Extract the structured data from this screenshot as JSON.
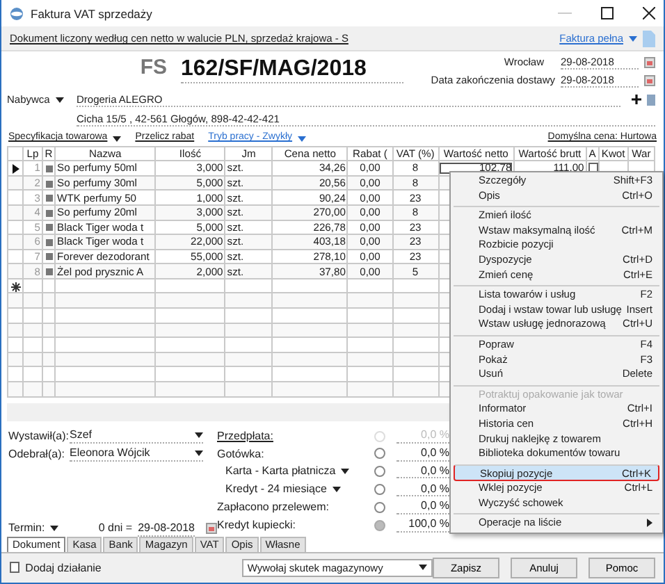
{
  "window": {
    "title": "Faktura VAT sprzedaży"
  },
  "info_bar": {
    "text": "Dokument liczony według cen netto w walucie PLN, sprzedaż krajowa - S",
    "doc_type": "Faktura pełna"
  },
  "header": {
    "prefix": "FS",
    "number": "162/SF/MAG/2018",
    "place": "Wrocław",
    "issue_date": "29-08-2018",
    "delivery_label": "Data zakończenia dostawy",
    "delivery_date": "29-08-2018",
    "buyer_label": "Nabywca",
    "buyer_name": "Drogeria ALEGRO",
    "buyer_address": "Cicha  15/5 , 42-561 Głogów, 898-42-42-421"
  },
  "toolbar": {
    "spec": "Specyfikacja towarowa",
    "rabat": "Przelicz rabat",
    "mode": "Tryb pracy - Zwykły",
    "default_price": "Domyślna cena: Hurtowa"
  },
  "table": {
    "columns": [
      "Lp",
      "R",
      "Nazwa",
      "Ilość",
      "Jm",
      "Cena netto",
      "Rabat (",
      "VAT (%)",
      "Wartość netto",
      "Wartość brutt",
      "A",
      "Kwot",
      "War"
    ],
    "rows": [
      {
        "lp": "1",
        "name": "So perfumy 50ml",
        "qty": "3,000",
        "unit": "szt.",
        "price": "34,26",
        "discount": "0,00",
        "vat": "8",
        "net": "102,78",
        "gross": "111,00",
        "a_checked": false,
        "selected": true
      },
      {
        "lp": "2",
        "name": "So perfumy 30ml",
        "qty": "5,000",
        "unit": "szt.",
        "price": "20,56",
        "discount": "0,00",
        "vat": "8",
        "selected": false
      },
      {
        "lp": "3",
        "name": "WTK perfumy 50",
        "qty": "1,000",
        "unit": "szt.",
        "price": "90,24",
        "discount": "0,00",
        "vat": "23",
        "selected": false
      },
      {
        "lp": "4",
        "name": "So perfumy 20ml",
        "qty": "3,000",
        "unit": "szt.",
        "price": "270,00",
        "discount": "0,00",
        "vat": "8",
        "selected": false
      },
      {
        "lp": "5",
        "name": "Black Tiger woda t",
        "qty": "5,000",
        "unit": "szt.",
        "price": "226,78",
        "discount": "0,00",
        "vat": "23",
        "selected": false
      },
      {
        "lp": "6",
        "name": "Black Tiger woda t",
        "qty": "22,000",
        "unit": "szt.",
        "price": "403,18",
        "discount": "0,00",
        "vat": "23",
        "selected": false
      },
      {
        "lp": "7",
        "name": "Forever dezodorant",
        "qty": "55,000",
        "unit": "szt.",
        "price": "278,10",
        "discount": "0,00",
        "vat": "23",
        "selected": false
      },
      {
        "lp": "8",
        "name": "Żel pod prysznic A",
        "qty": "2,000",
        "unit": "szt.",
        "price": "37,80",
        "discount": "0,00",
        "vat": "5",
        "selected": false
      }
    ]
  },
  "people": [
    {
      "label": "Wystawił(a):",
      "value": "Szef"
    },
    {
      "label": "Odebrał(a):",
      "value": "Eleonora Wójcik"
    }
  ],
  "term": {
    "label": "Termin:",
    "days": "0 dni =",
    "date": "29-08-2018"
  },
  "payments": [
    {
      "label": "Przedpłata:",
      "kind": "link",
      "has_menu": false,
      "disabled": true,
      "selected": false,
      "percent": "0,0 %"
    },
    {
      "label": "Gotówka:",
      "kind": "plain",
      "has_menu": false,
      "disabled": false,
      "selected": false,
      "percent": "0,0 %"
    },
    {
      "label": "Karta - Karta płatnicza",
      "kind": "plain",
      "has_menu": true,
      "disabled": false,
      "selected": false,
      "percent": "0,0 %"
    },
    {
      "label": "Kredyt - 24 miesiące",
      "kind": "plain",
      "has_menu": true,
      "disabled": false,
      "selected": false,
      "percent": "0,0 %"
    },
    {
      "label": "Zapłacono przelewem:",
      "kind": "plain",
      "has_menu": false,
      "disabled": false,
      "selected": false,
      "percent": "0,0 %"
    },
    {
      "label": "Kredyt kupiecki:",
      "kind": "plain",
      "has_menu": false,
      "disabled": false,
      "selected": true,
      "percent": "100,0 %"
    }
  ],
  "tabs": [
    {
      "label": "Dokument",
      "selected": true
    },
    {
      "label": "Kasa",
      "selected": false
    },
    {
      "label": "Bank",
      "selected": false
    },
    {
      "label": "Magazyn",
      "selected": false
    },
    {
      "label": "VAT",
      "selected": false
    },
    {
      "label": "Opis",
      "selected": false
    },
    {
      "label": "Własne",
      "selected": false
    }
  ],
  "footer": {
    "action_label": "Dodaj działanie",
    "action_checked": false,
    "effect": "Wywołaj skutek magazynowy",
    "buttons": [
      "Zapisz",
      "Anuluj",
      "Pomoc"
    ]
  },
  "context_menu": [
    {
      "label": "Szczegóły",
      "shortcut": "Shift+F3",
      "separator_before": false,
      "disabled": false,
      "highlighted": false,
      "submenu": false
    },
    {
      "label": "Opis",
      "shortcut": "Ctrl+O",
      "separator_before": false,
      "disabled": false,
      "highlighted": false,
      "submenu": false
    },
    {
      "label": "Zmień ilość",
      "separator_before": true,
      "disabled": false,
      "highlighted": false,
      "submenu": false
    },
    {
      "label": "Wstaw maksymalną ilość",
      "shortcut": "Ctrl+M",
      "separator_before": false,
      "disabled": false,
      "highlighted": false,
      "submenu": false
    },
    {
      "label": "Rozbicie pozycji",
      "separator_before": false,
      "disabled": false,
      "highlighted": false,
      "submenu": false
    },
    {
      "label": "Dyspozycje",
      "shortcut": "Ctrl+D",
      "separator_before": false,
      "disabled": false,
      "highlighted": false,
      "submenu": false
    },
    {
      "label": "Zmień cenę",
      "shortcut": "Ctrl+E",
      "separator_before": false,
      "disabled": false,
      "highlighted": false,
      "submenu": false
    },
    {
      "label": "Lista towarów i usług",
      "shortcut": "F2",
      "separator_before": true,
      "disabled": false,
      "highlighted": false,
      "submenu": false
    },
    {
      "label": "Dodaj i wstaw towar lub usługę",
      "shortcut": "Insert",
      "separator_before": false,
      "disabled": false,
      "highlighted": false,
      "submenu": false
    },
    {
      "label": "Wstaw usługę jednorazową",
      "shortcut": "Ctrl+U",
      "separator_before": false,
      "disabled": false,
      "highlighted": false,
      "submenu": false
    },
    {
      "label": "Popraw",
      "shortcut": "F4",
      "separator_before": true,
      "disabled": false,
      "highlighted": false,
      "submenu": false
    },
    {
      "label": "Pokaż",
      "shortcut": "F3",
      "separator_before": false,
      "disabled": false,
      "highlighted": false,
      "submenu": false
    },
    {
      "label": "Usuń",
      "shortcut": "Delete",
      "separator_before": false,
      "disabled": false,
      "highlighted": false,
      "submenu": false
    },
    {
      "label": "Potraktuj opakowanie jak towar",
      "separator_before": true,
      "disabled": true,
      "highlighted": false,
      "submenu": false
    },
    {
      "label": "Informator",
      "shortcut": "Ctrl+I",
      "separator_before": false,
      "disabled": false,
      "highlighted": false,
      "submenu": false
    },
    {
      "label": "Historia cen",
      "shortcut": "Ctrl+H",
      "separator_before": false,
      "disabled": false,
      "highlighted": false,
      "submenu": false
    },
    {
      "label": "Drukuj naklejkę z towarem",
      "separator_before": false,
      "disabled": false,
      "highlighted": false,
      "submenu": false
    },
    {
      "label": "Biblioteka dokumentów towaru",
      "separator_before": false,
      "disabled": false,
      "highlighted": false,
      "submenu": false
    },
    {
      "label": "Skopiuj pozycje",
      "shortcut": "Ctrl+K",
      "separator_before": true,
      "disabled": false,
      "highlighted": true,
      "submenu": false
    },
    {
      "label": "Wklej pozycje",
      "shortcut": "Ctrl+L",
      "separator_before": false,
      "disabled": false,
      "highlighted": false,
      "submenu": false
    },
    {
      "label": "Wyczyść schowek",
      "separator_before": false,
      "disabled": false,
      "highlighted": false,
      "submenu": false
    },
    {
      "label": "Operacje na liście",
      "separator_before": true,
      "disabled": false,
      "highlighted": false,
      "submenu": true
    }
  ]
}
